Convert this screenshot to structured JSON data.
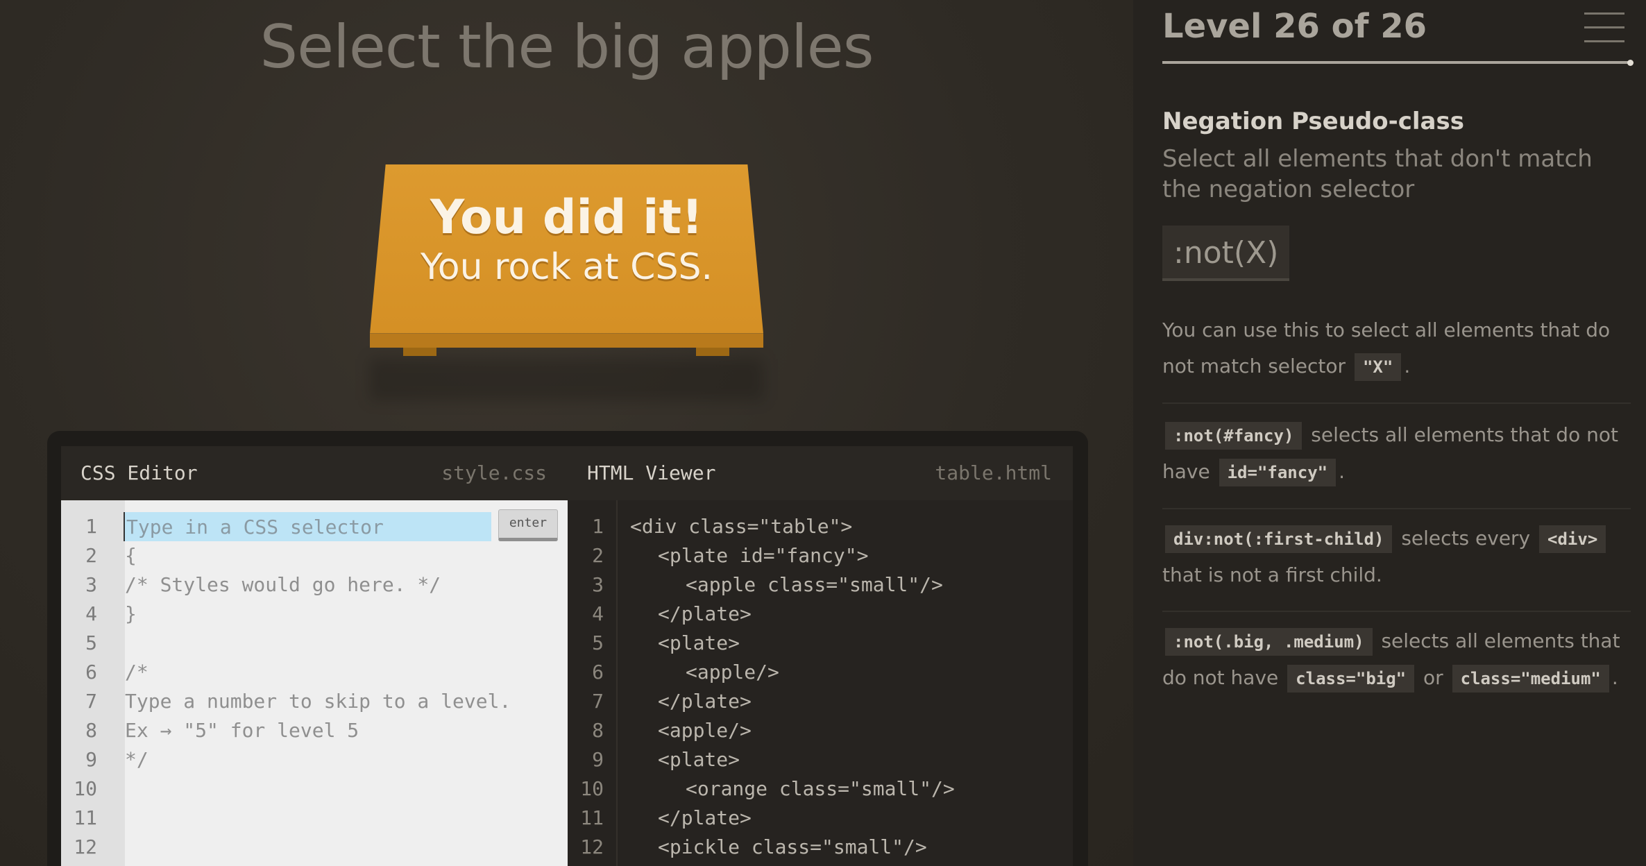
{
  "game": {
    "instruction": "Select the big apples",
    "win_title": "You did it!",
    "win_subtitle": "You rock at CSS."
  },
  "css_editor": {
    "title": "CSS Editor",
    "filename": "style.css",
    "placeholder": "Type in a CSS selector",
    "enter_label": "enter",
    "line_numbers": [
      "1",
      "2",
      "3",
      "4",
      "5",
      "6",
      "7",
      "8",
      "9",
      "10",
      "11",
      "12"
    ],
    "lines": [
      "",
      "{",
      "/* Styles would go here. */",
      "}",
      "",
      "/*",
      "Type a number to skip to a level.",
      "Ex → \"5\" for level 5",
      "*/"
    ]
  },
  "html_viewer": {
    "title": "HTML Viewer",
    "filename": "table.html",
    "line_numbers": [
      "1",
      "2",
      "3",
      "4",
      "5",
      "6",
      "7",
      "8",
      "9",
      "10",
      "11",
      "12"
    ],
    "lines": [
      "<div class=\"table\">",
      "<plate id=\"fancy\">",
      "<apple class=\"small\"/>",
      "</plate>",
      "<plate>",
      "<apple/>",
      "</plate>",
      "<apple/>",
      "<plate>",
      "<orange class=\"small\"/>",
      "</plate>",
      "<pickle class=\"small\"/>"
    ]
  },
  "sidebar": {
    "level_label": "Level 26 of 26",
    "progress": 1.0,
    "selector_name": "Negation Pseudo-class",
    "title": "Select all elements that don't match the negation selector",
    "syntax": ":not(X)",
    "hint": {
      "before": "You can use this to select all elements that do not match selector",
      "code": "\"X\"",
      "after": "."
    },
    "examples": [
      {
        "parts": [
          {
            "t": "code",
            "v": ":not(#fancy)"
          },
          {
            "t": "text",
            "v": " selects all elements that do not have "
          },
          {
            "t": "code",
            "v": "id=\"fancy\""
          },
          {
            "t": "text",
            "v": "."
          }
        ]
      },
      {
        "parts": [
          {
            "t": "code",
            "v": "div:not(:first-child)"
          },
          {
            "t": "text",
            "v": " selects every "
          },
          {
            "t": "code",
            "v": "<div>"
          },
          {
            "t": "text",
            "v": " that is not a first child."
          }
        ]
      },
      {
        "parts": [
          {
            "t": "code",
            "v": ":not(.big, .medium)"
          },
          {
            "t": "text",
            "v": " selects all elements that do not have "
          },
          {
            "t": "code",
            "v": "class=\"big\""
          },
          {
            "t": "text",
            "v": " or "
          },
          {
            "t": "code",
            "v": "class=\"medium\""
          },
          {
            "t": "text",
            "v": "."
          }
        ]
      }
    ]
  }
}
